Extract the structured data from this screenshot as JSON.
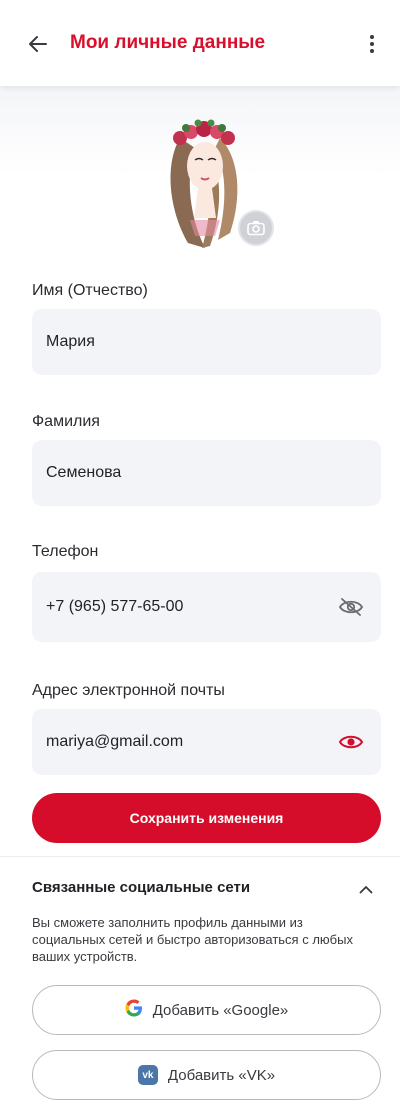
{
  "header": {
    "title": "Мои личные данные"
  },
  "icons": {
    "back": "arrow-left-icon",
    "more": "more-vertical-icon",
    "camera": "camera-icon",
    "eye_hidden": "eye-off-icon",
    "eye_visible": "eye-icon",
    "collapse": "chevron-up-icon",
    "google": "google-icon",
    "vk": "vk-icon"
  },
  "profile": {
    "fields": [
      {
        "label": "Имя (Отчество)",
        "value": "Мария"
      },
      {
        "label": "Фамилия",
        "value": "Семенова"
      },
      {
        "label": "Телефон",
        "value": "+7 (965) 577-65-00"
      },
      {
        "label": "Адрес электронной почты",
        "value": "mariya@gmail.com"
      }
    ],
    "save_label": "Сохранить изменения"
  },
  "social": {
    "title": "Связанные социальные сети",
    "description": "Вы сможете заполнить профиль данными из социальных сетей и быстро авторизоваться с любых ваших устройств.",
    "google_label": "Добавить «Google»",
    "vk_label": "Добавить «VK»",
    "vk_badge": "vk"
  },
  "colors": {
    "accent": "#d50d2a",
    "field_bg": "#f3f4f8",
    "vk": "#4a76a8"
  }
}
